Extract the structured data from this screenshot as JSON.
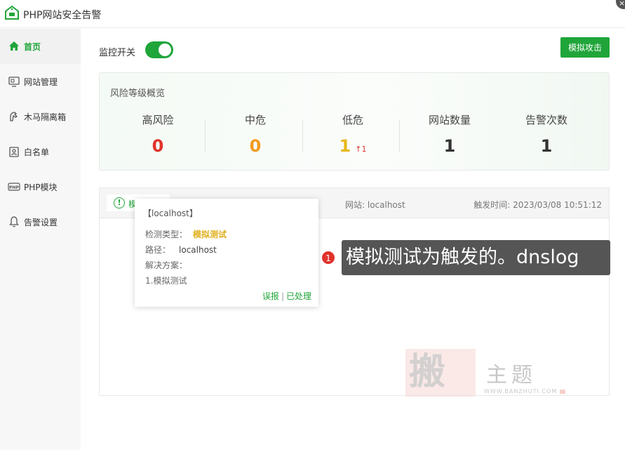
{
  "window": {
    "title": "PHP网站安全告警",
    "logo_icon": "php-house-logo-icon",
    "close_icon": "close-icon",
    "close_glyph": "×"
  },
  "sidebar": {
    "items": [
      {
        "label": "首页",
        "icon": "home-icon",
        "active": true
      },
      {
        "label": "网站管理",
        "icon": "website-icon",
        "active": false
      },
      {
        "label": "木马隔离箱",
        "icon": "trojan-icon",
        "active": false
      },
      {
        "label": "白名单",
        "icon": "whitelist-icon",
        "active": false
      },
      {
        "label": "PHP模块",
        "icon": "php-icon",
        "active": false
      },
      {
        "label": "告警设置",
        "icon": "bell-icon",
        "active": false
      }
    ]
  },
  "main": {
    "monitor_label": "监控开关",
    "monitor_on": true,
    "simulate_button": "模拟攻击",
    "risk": {
      "title": "风险等级概览",
      "stats": [
        {
          "label": "高风险",
          "value": "0",
          "color": "#e0322b"
        },
        {
          "label": "中危",
          "value": "0",
          "color": "#f39a1e"
        },
        {
          "label": "低危",
          "value": "1",
          "color": "#e8b81f",
          "delta": "↑1"
        },
        {
          "label": "网站数量",
          "value": "1",
          "color": "#333333"
        },
        {
          "label": "告警次数",
          "value": "1",
          "color": "#333333"
        }
      ]
    },
    "alert": {
      "tag_icon": "info-circle-icon",
      "tag_glyph": "!",
      "tag_text": "模",
      "site": "网站: localhost",
      "time": "触发时间: 2023/03/08 10:51:12"
    },
    "popup": {
      "head": "【localhost】",
      "type_label": "检测类型：",
      "type_value": "模拟测试",
      "path_label": "路径：",
      "path_value": "localhost",
      "solution_label": "解决方案：",
      "solution_value": "1.模拟测试",
      "link_false": "误报",
      "link_sep": "|",
      "link_handled": "已处理"
    },
    "callout": {
      "badge": "1",
      "text": "模拟测试为触发的。dnslog"
    },
    "watermark": {
      "big": "搬",
      "side": "主题",
      "url": "WWW.BANZHUTI.COM"
    }
  },
  "colors": {
    "accent": "#20a53a",
    "danger": "#e0322b",
    "warning": "#f39a1e",
    "low": "#e8b81f"
  }
}
